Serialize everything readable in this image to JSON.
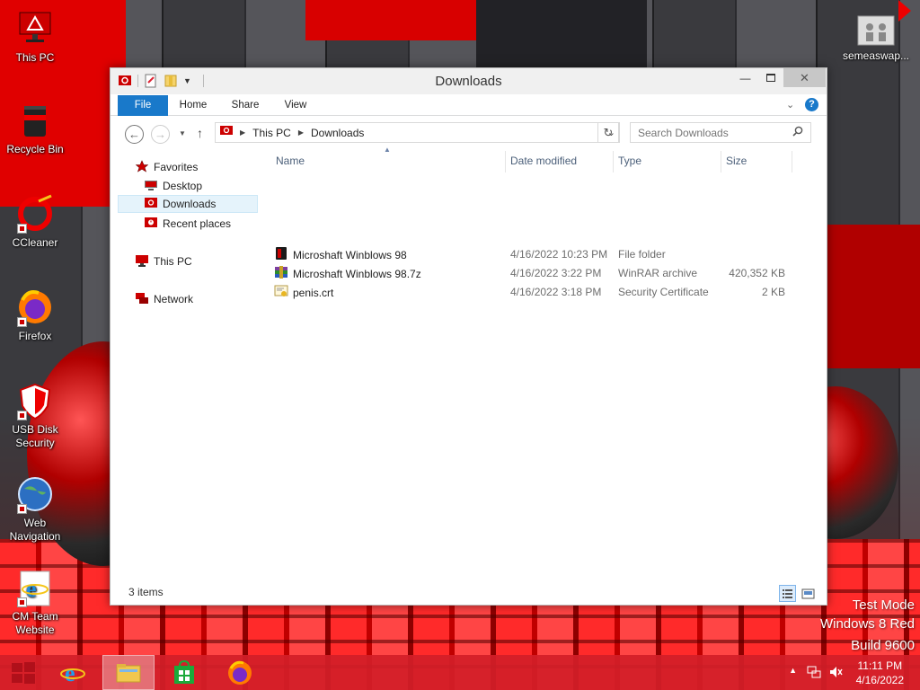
{
  "desktop": {
    "icons": [
      {
        "label": "This PC"
      },
      {
        "label": "Recycle Bin"
      },
      {
        "label": "CCleaner"
      },
      {
        "label": "Firefox"
      },
      {
        "label": "USB Disk Security"
      },
      {
        "label": "Web Navigation"
      },
      {
        "label": "CM Team Website"
      },
      {
        "label": "semeaswap..."
      }
    ],
    "watermark": {
      "line1": "Test Mode",
      "line2": "Windows 8 Red",
      "line3": "Build 9600"
    }
  },
  "window": {
    "title": "Downloads",
    "ribbon_tabs": [
      "File",
      "Home",
      "Share",
      "View"
    ],
    "address": {
      "crumbs": [
        "This PC",
        "Downloads"
      ]
    },
    "search": {
      "placeholder": "Search Downloads"
    },
    "nav": {
      "favorites": "Favorites",
      "desktop": "Desktop",
      "downloads": "Downloads",
      "recent": "Recent places",
      "this_pc": "This PC",
      "network": "Network"
    },
    "columns": {
      "name": "Name",
      "date": "Date modified",
      "type": "Type",
      "size": "Size"
    },
    "files": [
      {
        "name": "Microshaft Winblows 98",
        "date": "4/16/2022 10:23 PM",
        "type": "File folder",
        "size": "",
        "icon": "folder-icon"
      },
      {
        "name": "Microshaft Winblows 98.7z",
        "date": "4/16/2022 3:22 PM",
        "type": "WinRAR archive",
        "size": "420,352 KB",
        "icon": "archive-icon"
      },
      {
        "name": "penis.crt",
        "date": "4/16/2022 3:18 PM",
        "type": "Security Certificate",
        "size": "2 KB",
        "icon": "certificate-icon"
      }
    ],
    "status": "3 items"
  },
  "taskbar": {
    "clock_time": "11:11 PM",
    "clock_date": "4/16/2022"
  },
  "colors": {
    "accent": "#1979ca",
    "taskbar": "#d21e28",
    "desktop_red": "#d00000"
  }
}
